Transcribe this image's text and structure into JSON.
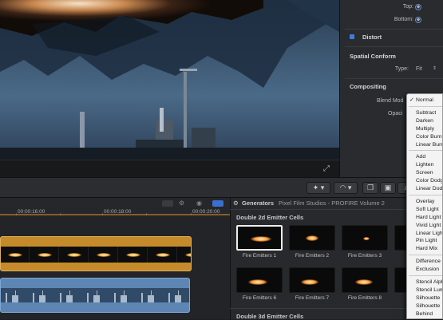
{
  "inspector": {
    "top_label": "Top:",
    "bottom_label": "Bottom:",
    "distort_title": "Distort",
    "spatial_title": "Spatial Conform",
    "type_label": "Type:",
    "type_value": "Fit",
    "compositing_title": "Compositing",
    "blend_label": "Blend Mod",
    "opacity_label": "Opaci"
  },
  "blend_menu": {
    "selected": "Normal",
    "groups": [
      [
        "Normal"
      ],
      [
        "Subtract",
        "Darken",
        "Multiply",
        "Color Burn",
        "Linear Burn"
      ],
      [
        "Add",
        "Lighten",
        "Screen",
        "Color Dodge",
        "Linear Dodge"
      ],
      [
        "Overlay",
        "Soft Light",
        "Hard Light",
        "Vivid Light",
        "Linear Light",
        "Pin Light",
        "Hard Mix"
      ],
      [
        "Difference",
        "Exclusion"
      ],
      [
        "Stencil Alpha",
        "Stencil Luma",
        "Silhouette",
        "Silhouette",
        "Behind"
      ]
    ]
  },
  "timeline": {
    "timecodes": [
      "00:00:16:00",
      "00:00:18:00",
      "00:00:20:00"
    ]
  },
  "browser": {
    "tab_label": "Generators",
    "path_label": "Pixel Film Studios - PROFIRE Volume 2",
    "category1": "Double 2d Emitter Cells",
    "category2": "Double 3d Emitter Cells",
    "thumbs": [
      "Fire Emitters 1",
      "Fire Emitters 2",
      "Fire Emitters 3",
      "",
      "Fire Emitters 6",
      "Fire Emitters 7",
      "Fire Emitters 8",
      ""
    ]
  },
  "colors": {
    "accent": "#3e7be0",
    "clip_gold": "#c58a2a",
    "clip_blue": "#5e86b4"
  }
}
